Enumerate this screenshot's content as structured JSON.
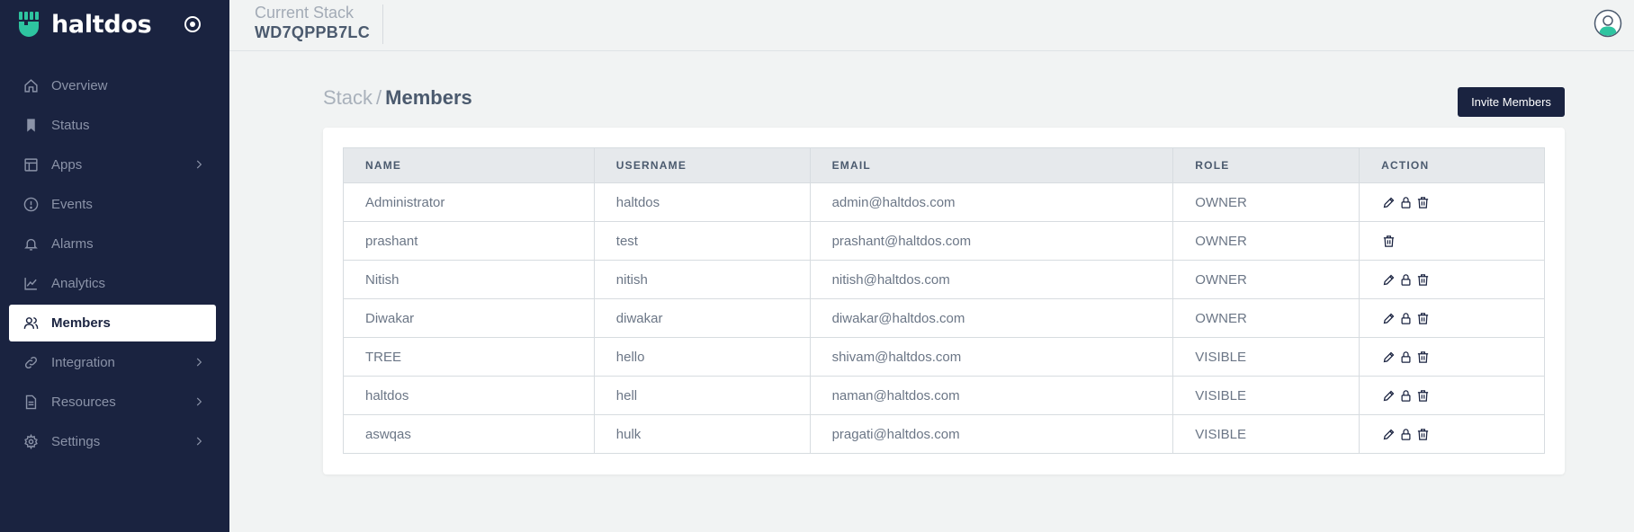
{
  "brand": {
    "name": "haltdos"
  },
  "sidebar": {
    "items": [
      {
        "label": "Overview",
        "icon": "home-icon",
        "chevron": false,
        "active": false
      },
      {
        "label": "Status",
        "icon": "bookmark-icon",
        "chevron": false,
        "active": false
      },
      {
        "label": "Apps",
        "icon": "layout-icon",
        "chevron": true,
        "active": false
      },
      {
        "label": "Events",
        "icon": "alert-circle-icon",
        "chevron": false,
        "active": false
      },
      {
        "label": "Alarms",
        "icon": "bell-icon",
        "chevron": false,
        "active": false
      },
      {
        "label": "Analytics",
        "icon": "line-chart-icon",
        "chevron": false,
        "active": false
      },
      {
        "label": "Members",
        "icon": "users-icon",
        "chevron": false,
        "active": true
      },
      {
        "label": "Integration",
        "icon": "link-icon",
        "chevron": true,
        "active": false
      },
      {
        "label": "Resources",
        "icon": "file-icon",
        "chevron": true,
        "active": false
      },
      {
        "label": "Settings",
        "icon": "gear-icon",
        "chevron": true,
        "active": false
      }
    ]
  },
  "topbar": {
    "stack_caption": "Current Stack",
    "stack_id": "WD7QPPB7LC"
  },
  "page": {
    "breadcrumb_parent": "Stack",
    "breadcrumb_sep": "/",
    "breadcrumb_current": "Members",
    "invite_label": "Invite Members"
  },
  "table": {
    "headers": [
      "NAME",
      "USERNAME",
      "EMAIL",
      "ROLE",
      "ACTION"
    ],
    "rows": [
      {
        "name": "Administrator",
        "username": "haltdos",
        "email": "admin@haltdos.com",
        "role": "OWNER",
        "actions": [
          "edit",
          "lock",
          "delete"
        ]
      },
      {
        "name": "prashant",
        "username": "test",
        "email": "prashant@haltdos.com",
        "role": "OWNER",
        "actions": [
          "delete"
        ]
      },
      {
        "name": "Nitish",
        "username": "nitish",
        "email": "nitish@haltdos.com",
        "role": "OWNER",
        "actions": [
          "edit",
          "lock",
          "delete"
        ]
      },
      {
        "name": "Diwakar",
        "username": "diwakar",
        "email": "diwakar@haltdos.com",
        "role": "OWNER",
        "actions": [
          "edit",
          "lock",
          "delete"
        ]
      },
      {
        "name": "TREE",
        "username": "hello",
        "email": "shivam@haltdos.com",
        "role": "VISIBLE",
        "actions": [
          "edit",
          "lock",
          "delete"
        ]
      },
      {
        "name": "haltdos",
        "username": "hell",
        "email": "naman@haltdos.com",
        "role": "VISIBLE",
        "actions": [
          "edit",
          "lock",
          "delete"
        ]
      },
      {
        "name": "aswqas",
        "username": "hulk",
        "email": "pragati@haltdos.com",
        "role": "VISIBLE",
        "actions": [
          "edit",
          "lock",
          "delete"
        ]
      }
    ]
  },
  "colors": {
    "sidebar_bg": "#1a2340",
    "brand_accent": "#2ec4a0",
    "page_bg": "#f1f3f3"
  }
}
